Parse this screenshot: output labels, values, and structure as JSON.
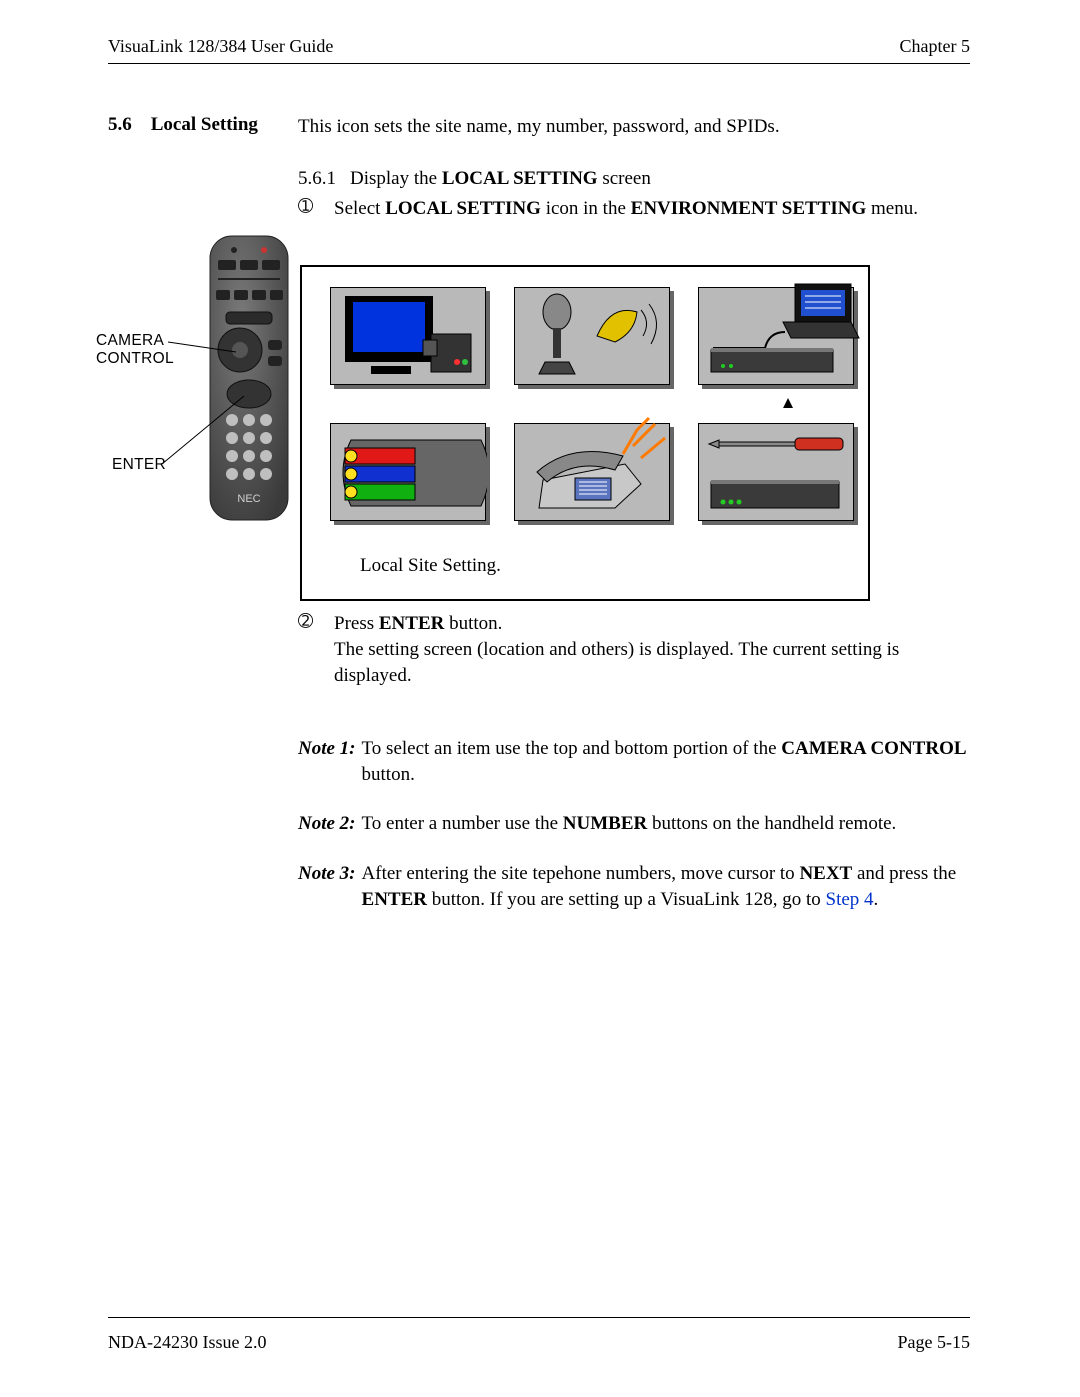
{
  "header": {
    "left": "VisuaLink 128/384 User Guide",
    "right": "Chapter 5"
  },
  "section": {
    "number": "5.6",
    "title": "Local Setting",
    "intro": "This icon sets the site name, my number, password, and SPIDs.",
    "sub_number": "5.6.1",
    "sub_text_prefix": "Display the ",
    "sub_text_bold": "LOCAL SETTING",
    "sub_text_suffix": " screen",
    "step1_marker": "➀",
    "step1_prefix": "Select ",
    "step1_bold1": "LOCAL SETTING",
    "step1_mid": " icon in the ",
    "step1_bold2": "ENVIRONMENT SETTING",
    "step1_suffix": " menu.",
    "panel_caption": "Local Site Setting.",
    "step2_marker": "➁",
    "step2_line1_prefix": "Press ",
    "step2_line1_bold": "ENTER",
    "step2_line1_suffix": " button.",
    "step2_line2": "The setting screen (location and others) is displayed.  The current setting is displayed."
  },
  "remote_labels": {
    "camera_control_line1": "CAMERA",
    "camera_control_line2": "CONTROL",
    "enter": "ENTER"
  },
  "panel": {
    "indicator": "▲"
  },
  "notes": {
    "n1_label": "Note 1:",
    "n1_prefix": " To select an item use the top and bottom portion of the ",
    "n1_bold": "CAMERA CONTROL",
    "n1_suffix": " button.",
    "n2_label": "Note 2:",
    "n2_prefix": " To enter a number use the ",
    "n2_bold": "NUMBER",
    "n2_suffix": " buttons on the handheld remote.",
    "n3_label": "Note 3:",
    "n3_prefix": " After entering the site tepehone numbers, move cursor to ",
    "n3_bold1": "NEXT",
    "n3_mid1": " and press the ",
    "n3_bold2": "ENTER",
    "n3_mid2": " button.  If you are setting up a VisuaLink 128, go to ",
    "n3_link": "Step 4",
    "n3_suffix": "."
  },
  "footer": {
    "left": "NDA-24230 Issue 2.0",
    "right": "Page 5-15"
  }
}
